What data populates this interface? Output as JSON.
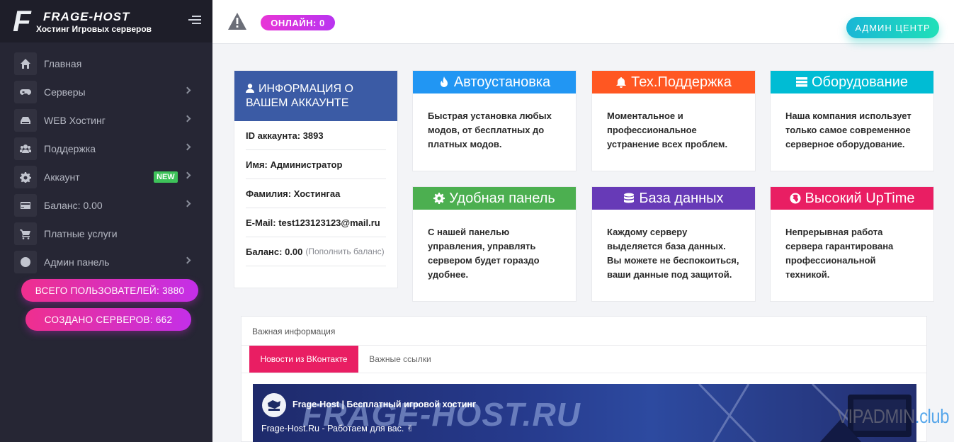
{
  "brand": {
    "letter": "F",
    "name": "FRAGE-HOST",
    "subtitle": "Хостинг Игровых серверов"
  },
  "sidebar": {
    "items": [
      {
        "label": "Главная",
        "icon": "home-icon",
        "chevron": false
      },
      {
        "label": "Серверы",
        "icon": "gamepad-icon",
        "chevron": true
      },
      {
        "label": "WEB Хостинг",
        "icon": "hdd-icon",
        "chevron": true
      },
      {
        "label": "Поддержка",
        "icon": "users-icon",
        "chevron": true
      },
      {
        "label": "Аккаунт",
        "icon": "gear-icon",
        "chevron": true,
        "badge": "NEW"
      },
      {
        "label": "Баланс: 0.00",
        "icon": "credit-card-icon",
        "chevron": true
      },
      {
        "label": "Платные услуги",
        "icon": "cart-icon",
        "chevron": false
      },
      {
        "label": "Админ панель",
        "icon": "globe-icon",
        "chevron": true
      }
    ],
    "stats": {
      "users": "ВСЕГО ПОЛЬЗОВАТЕЛЕЙ: 3880",
      "servers": "СОЗДАНО СЕРВЕРОВ: 662"
    }
  },
  "topbar": {
    "online": "ОНЛАЙН: 0",
    "admin_button": "АДМИН ЦЕНТР"
  },
  "account": {
    "title": "ИНФОРМАЦИЯ О ВАШЕМ АККАУНТЕ",
    "id": "ID аккаунта: 3893",
    "first_name": "Имя: Администратор",
    "last_name": "Фамилия: Хостингаа",
    "email": "E-Mail: test123123123@mail.ru",
    "balance": "Баланс: 0.00",
    "topup": "(Пополнить баланс)"
  },
  "features": [
    {
      "title": "Автоустановка",
      "icon": "fire-icon",
      "color": "#2196f3",
      "text": "Быстрая установка любых модов, от бесплатных до платных модов."
    },
    {
      "title": "Тех.Поддержка",
      "icon": "bell-icon",
      "color": "#ff5722",
      "text": "Моментальное и профессиональное устранение всех проблем."
    },
    {
      "title": "Оборудование",
      "icon": "server-icon",
      "color": "#00bcd4",
      "text": "Наша компания использует только самое современное серверное оборудование."
    },
    {
      "title": "Удобная панель",
      "icon": "cog-icon",
      "color": "#4caf50",
      "text": "С нашей панелью управления, управлять сервером будет гораздо удобнее."
    },
    {
      "title": "База данных",
      "icon": "database-icon",
      "color": "#673ab7",
      "text": "Каждому серверу выделяется база данных. Вы можете не беспокоиться, ваши данные под защитой."
    },
    {
      "title": "Высокий UpTime",
      "icon": "globe-icon",
      "color": "#e91e63",
      "text": "Непрерывная работа сервера гарантирована профессиональной техникой."
    }
  ],
  "info": {
    "title": "Важная информация",
    "tabs": [
      {
        "label": "Новости из ВКонтакте"
      },
      {
        "label": "Важные ссылки"
      }
    ],
    "banner": {
      "big_text": "FRAGE-HOST.RU",
      "group_name": "Frage-Host | Бесплатный игровой хостинг",
      "subline": "Frage-Host.Ru - Работаем для вас. ✌"
    }
  },
  "watermark": {
    "main": "VIPADMIN",
    "suffix": ".club"
  }
}
